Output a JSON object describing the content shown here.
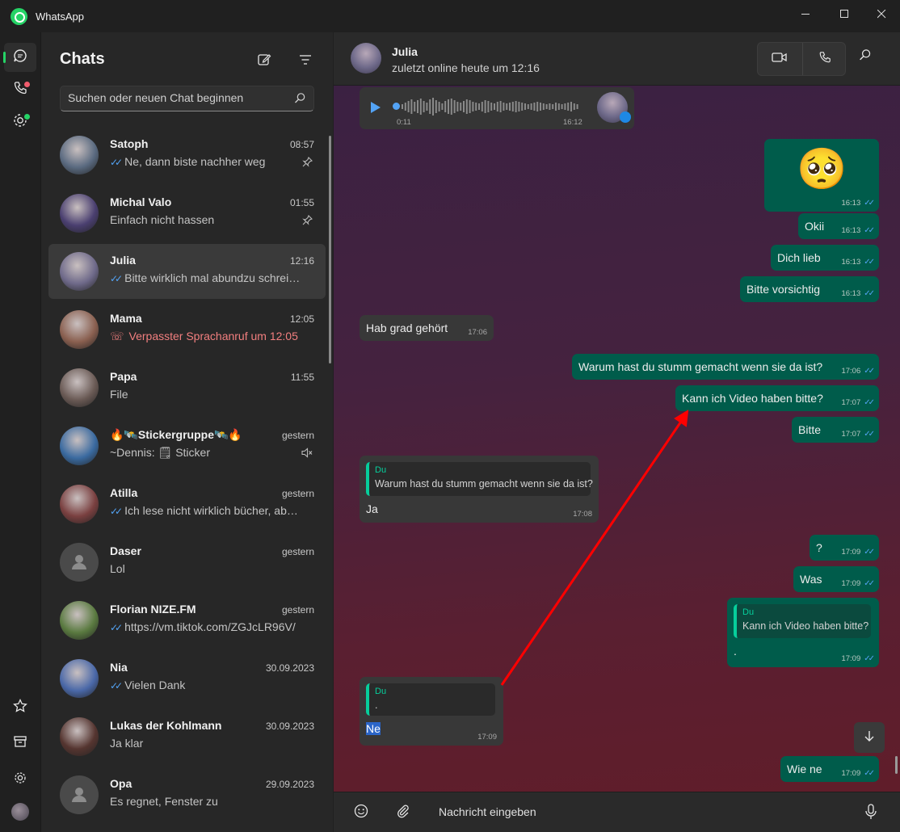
{
  "window": {
    "title": "WhatsApp",
    "minimize_icon": "minimize-icon",
    "maximize_icon": "maximize-icon",
    "close_icon": "close-icon"
  },
  "rail": {
    "items": [
      {
        "name": "chats",
        "icon": "chat-icon",
        "active": true
      },
      {
        "name": "calls",
        "icon": "phone-icon",
        "badge_color": "#f15c6d"
      },
      {
        "name": "status",
        "icon": "status-icon",
        "badge_color": "#25d366"
      }
    ],
    "bottom": [
      {
        "name": "starred",
        "icon": "star-icon"
      },
      {
        "name": "archived",
        "icon": "archive-icon"
      },
      {
        "name": "settings",
        "icon": "gear-icon"
      },
      {
        "name": "profile",
        "icon": "avatar"
      }
    ]
  },
  "sidebar": {
    "title": "Chats",
    "new_chat_icon": "new-chat-icon",
    "filter_icon": "filter-icon",
    "search_placeholder": "Suchen oder neuen Chat beginnen",
    "chats": [
      {
        "name": "Satoph",
        "time": "08:57",
        "preview": "Ne, dann biste nachher weg",
        "ticks": true,
        "meta": "pin",
        "color": "#5a6a80"
      },
      {
        "name": "Michal Valo",
        "time": "01:55",
        "preview": "Einfach nicht hassen",
        "ticks": false,
        "meta": "pin",
        "color": "#4a3f70"
      },
      {
        "name": "Julia",
        "time": "12:16",
        "preview": "Bitte wirklich mal abundzu schreiben",
        "ticks": true,
        "meta": "",
        "color": "#6f6a8a",
        "selected": true
      },
      {
        "name": "Mama",
        "time": "12:05",
        "preview": "Verpasster Sprachanruf um 12:05",
        "ticks": false,
        "meta": "",
        "color": "#8a6050",
        "missed": true
      },
      {
        "name": "Papa",
        "time": "11:55",
        "preview": "File",
        "ticks": false,
        "meta": "",
        "color": "#6a5a55"
      },
      {
        "name": "🔥🛰️Stickergruppe🛰️🔥",
        "time": "gestern",
        "preview": "~Dennis: 🗒 Sticker",
        "ticks": false,
        "meta": "mute",
        "color": "#3a6aa0"
      },
      {
        "name": "Atilla",
        "time": "gestern",
        "preview": "Ich lese nicht wirklich bücher, aber das klingt gut",
        "ticks": true,
        "meta": "",
        "color": "#7a4040"
      },
      {
        "name": "Daser",
        "time": "gestern",
        "preview": "Lol",
        "ticks": false,
        "meta": "",
        "color": "",
        "default_avatar": true
      },
      {
        "name": "Florian NIZE.FM",
        "time": "gestern",
        "preview": "https://vm.tiktok.com/ZGJcLR96V/",
        "ticks": true,
        "meta": "",
        "color": "#5a7a40"
      },
      {
        "name": "Nia",
        "time": "30.09.2023",
        "preview": "Vielen Dank",
        "ticks": true,
        "meta": "",
        "color": "#4a68a8"
      },
      {
        "name": "Lukas der Kohlmann",
        "time": "30.09.2023",
        "preview": "Ja klar",
        "ticks": false,
        "meta": "",
        "color": "#553530"
      },
      {
        "name": "Opa",
        "time": "29.09.2023",
        "preview": "Es regnet, Fenster zu",
        "ticks": false,
        "meta": "",
        "color": "",
        "default_avatar": true
      }
    ]
  },
  "header": {
    "name": "Julia",
    "status": "zuletzt online heute um 12:16",
    "video_icon": "video-call-icon",
    "phone_icon": "voice-call-icon",
    "search_icon": "search-icon"
  },
  "voice_message": {
    "duration": "0:11",
    "time": "16:12",
    "progress": 0.0
  },
  "messages": [
    {
      "dir": "out",
      "text": "🥺",
      "time": "16:13",
      "emoji": true
    },
    {
      "dir": "out",
      "text": "Okii",
      "time": "16:13"
    },
    {
      "dir": "out",
      "text": "Dich lieb",
      "time": "16:13"
    },
    {
      "dir": "out",
      "text": "Bitte vorsichtig",
      "time": "16:13"
    },
    {
      "dir": "in",
      "text": "Hab grad gehört",
      "time": "17:06"
    },
    {
      "dir": "out",
      "text": "Warum hast du stumm gemacht wenn sie da ist?",
      "time": "17:06"
    },
    {
      "dir": "out",
      "text": "Kann ich Video haben bitte?",
      "time": "17:07"
    },
    {
      "dir": "out",
      "text": "Bitte",
      "time": "17:07"
    },
    {
      "dir": "in",
      "quote_author": "Du",
      "quote_text": "Warum hast du stumm gemacht wenn sie da ist?",
      "text": "Ja",
      "time": "17:08"
    },
    {
      "dir": "out",
      "text": "?",
      "time": "17:09"
    },
    {
      "dir": "out",
      "text": "Was",
      "time": "17:09"
    },
    {
      "dir": "out",
      "quote_author": "Du",
      "quote_text": "Kann ich Video haben bitte?",
      "text": ".",
      "time": "17:09"
    },
    {
      "dir": "in",
      "quote_author": "Du",
      "quote_text": ".",
      "text": "Ne",
      "time": "17:09"
    },
    {
      "dir": "out",
      "text": "Wie ne",
      "time": "17:09"
    }
  ],
  "composer": {
    "placeholder": "Nachricht eingeben",
    "emoji_icon": "emoji-icon",
    "attach_icon": "attach-icon",
    "mic_icon": "mic-icon"
  },
  "colors": {
    "accent": "#25d366",
    "outgoing": "#005c4b",
    "incoming": "#383838",
    "annotation_arrow": "#ff0000"
  }
}
